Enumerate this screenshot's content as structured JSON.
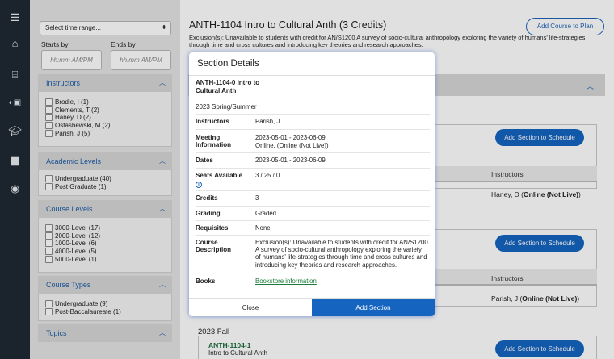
{
  "rail": {
    "icons": [
      "menu-icon",
      "home-icon",
      "institution-icon",
      "toggle-icon",
      "graduation-cap-icon",
      "briefcase-icon",
      "user-circle-icon"
    ]
  },
  "filters": {
    "time_select": "Select time range...",
    "starts_label": "Starts by",
    "ends_label": "Ends by",
    "starts_placeholder": "hh:mm AM/PM",
    "ends_placeholder": "hh:mm AM/PM",
    "instructors": {
      "title": "Instructors",
      "items": [
        "Brodie, I (1)",
        "Clements, T (2)",
        "Haney, D (2)",
        "Ostashewski, M (2)",
        "Parish, J (5)"
      ]
    },
    "academic_levels": {
      "title": "Academic Levels",
      "items": [
        "Undergraduate (40)",
        "Post Graduate (1)"
      ]
    },
    "course_levels": {
      "title": "Course Levels",
      "items": [
        "3000-Level (17)",
        "2000-Level (12)",
        "1000-Level (6)",
        "4000-Level (5)",
        "5000-Level (1)"
      ]
    },
    "course_types": {
      "title": "Course Types",
      "items": [
        "Undergraduate (9)",
        "Post-Baccalaureate (1)"
      ]
    },
    "topics": {
      "title": "Topics"
    }
  },
  "course": {
    "title": "ANTH-1104 Intro to Cultural Anth (3 Credits)",
    "add_to_plan": "Add Course to Plan",
    "description": "Exclusion(s): Unavailable to students with credit for AN/S1200 A survey of socio-cultural anthropology exploring the variety of humans' life-strategies through time and cross cultures and introducing key theories and research approaches.",
    "add_section_label": "Add Section to Schedule",
    "instructors_header": "Instructors",
    "section1_instructor": "Haney, D",
    "section2_instructor": "Parish, J",
    "online_tag": "Online (Not Live)",
    "term_fall": "2023 Fall",
    "fall_code": "ANTH-1104-1",
    "fall_name": "Intro to Cultural Anth"
  },
  "modal": {
    "title": "Section Details",
    "code": "ANTH-1104-0 Intro to Cultural Anth",
    "term": "2023 Spring/Summer",
    "rows": {
      "instructors_label": "Instructors",
      "instructors_value": "Parish, J",
      "meeting_label": "Meeting Information",
      "meeting_dates": "2023-05-01 - 2023-06-09",
      "meeting_mode": "Online, (Online (Not Live))",
      "dates_label": "Dates",
      "dates_value": "2023-05-01 - 2023-06-09",
      "seats_label": "Seats Available",
      "seats_value": "3 / 25 / 0",
      "credits_label": "Credits",
      "credits_value": "3",
      "grading_label": "Grading",
      "grading_value": "Graded",
      "requisites_label": "Requisites",
      "requisites_value": "None",
      "description_label": "Course Description",
      "description_value": "Exclusion(s): Unavailable to students with credit for AN/S1200 A survey of socio-cultural anthropology exploring the variety of humans' life-strategies through time and cross cultures and introducing key theories and research approaches.",
      "books_label": "Books",
      "books_value": "Bookstore information"
    },
    "close_label": "Close",
    "add_label": "Add Section"
  }
}
